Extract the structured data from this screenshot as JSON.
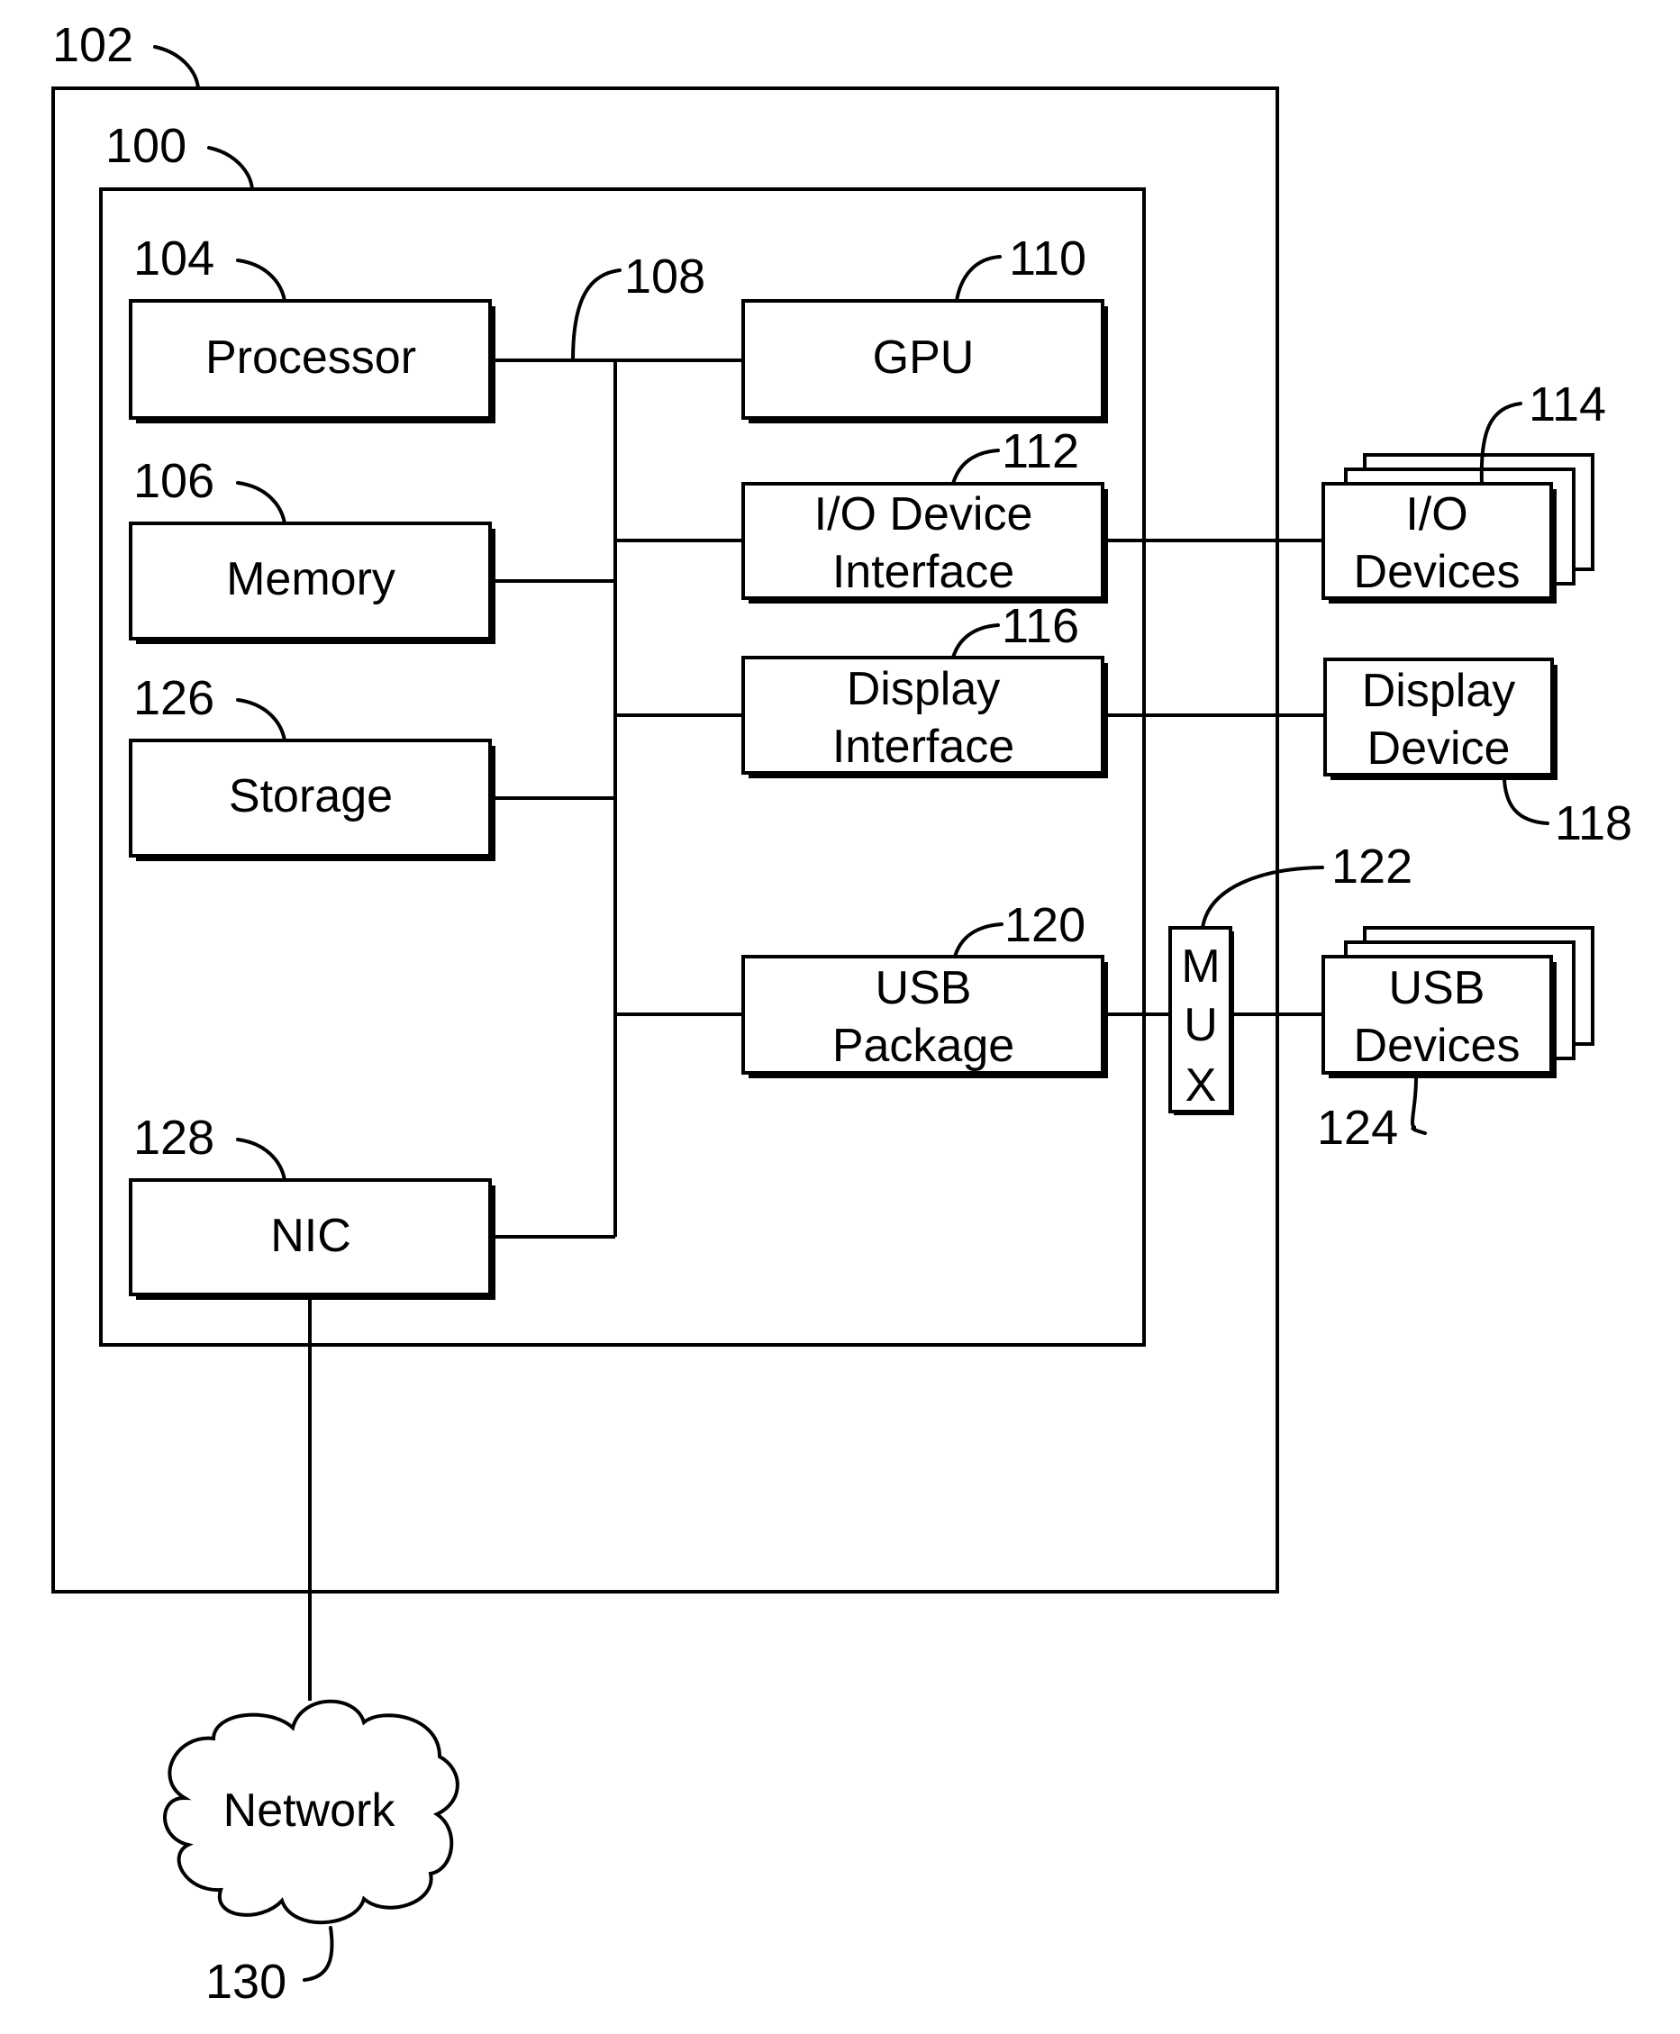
{
  "diagram": {
    "type": "block-diagram",
    "containers": {
      "outer": {
        "ref": "102"
      },
      "inner": {
        "ref": "100"
      }
    },
    "blocks": {
      "processor": {
        "ref": "104",
        "lines": [
          "Processor"
        ]
      },
      "memory": {
        "ref": "106",
        "lines": [
          "Memory"
        ]
      },
      "storage": {
        "ref": "126",
        "lines": [
          "Storage"
        ]
      },
      "nic": {
        "ref": "128",
        "lines": [
          "NIC"
        ]
      },
      "gpu": {
        "ref": "110",
        "lines": [
          "GPU"
        ]
      },
      "io_interface": {
        "ref": "112",
        "lines": [
          "I/O Device",
          "Interface"
        ]
      },
      "display_interface": {
        "ref": "116",
        "lines": [
          "Display",
          "Interface"
        ]
      },
      "usb_package": {
        "ref": "120",
        "lines": [
          "USB",
          "Package"
        ]
      },
      "mux": {
        "ref": "122",
        "letters": [
          "M",
          "U",
          "X"
        ]
      },
      "io_devices": {
        "ref": "114",
        "lines": [
          "I/O",
          "Devices"
        ]
      },
      "display_device": {
        "ref": "118",
        "lines": [
          "Display",
          "Device"
        ]
      },
      "usb_devices": {
        "ref": "124",
        "lines": [
          "USB",
          "Devices"
        ]
      },
      "network": {
        "ref": "130",
        "lines": [
          "Network"
        ]
      }
    },
    "bus": {
      "ref": "108"
    },
    "connections": [
      [
        "processor",
        "bus"
      ],
      [
        "memory",
        "bus"
      ],
      [
        "storage",
        "bus"
      ],
      [
        "nic",
        "bus"
      ],
      [
        "bus",
        "gpu"
      ],
      [
        "bus",
        "io_interface"
      ],
      [
        "bus",
        "display_interface"
      ],
      [
        "bus",
        "usb_package"
      ],
      [
        "io_interface",
        "io_devices"
      ],
      [
        "display_interface",
        "display_device"
      ],
      [
        "usb_package",
        "mux"
      ],
      [
        "mux",
        "usb_devices"
      ],
      [
        "nic",
        "network"
      ]
    ]
  }
}
